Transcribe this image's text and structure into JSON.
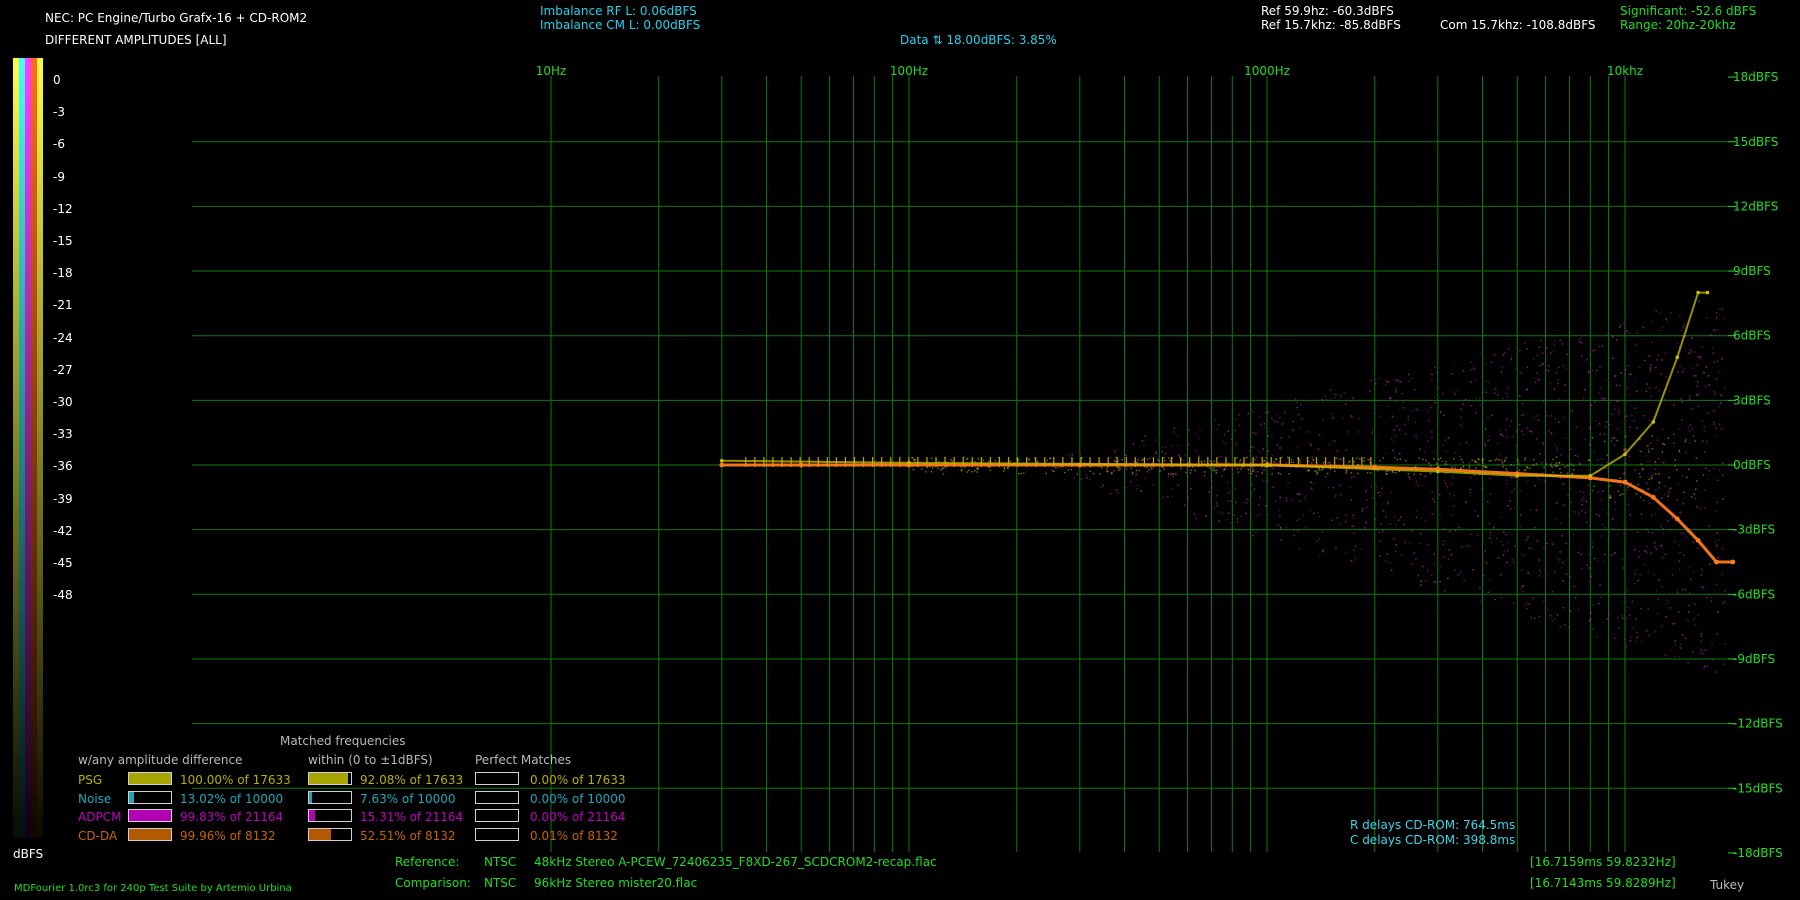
{
  "header": {
    "system": "NEC: PC Engine/Turbo Grafx-16 + CD-ROM2",
    "mode": "DIFFERENT AMPLITUDES [ALL]",
    "imbalance_rf": "Imbalance RF L: 0.06dBFS",
    "imbalance_cm": "Imbalance CM L: 0.00dBFS",
    "data_range": "Data ⇅ 18.00dBFS: 3.85%",
    "ref_60": "Ref 59.9hz:  -60.3dBFS",
    "ref_15k": "Ref 15.7khz: -85.8dBFS",
    "com_15k": "Com 15.7khz: -108.8dBFS",
    "significant": "Significant: -52.6 dBFS",
    "range": "Range: 20hz-20khz"
  },
  "colors": {
    "grid": "#0f7a0f",
    "label": "#22dd22",
    "psg": "#a7a500",
    "noise": "#21a3b3",
    "adpcm": "#b300b3",
    "cdda": "#b35a00",
    "trace": "#ff7a1a",
    "purple_points": "#b322b3"
  },
  "scale": {
    "labels": [
      "0",
      "-3",
      "-6",
      "-9",
      "-12",
      "-15",
      "-18",
      "-21",
      "-24",
      "-27",
      "-30",
      "-33",
      "-36",
      "-39",
      "-42",
      "-45",
      "-48"
    ],
    "unit": "dBFS"
  },
  "chart_data": {
    "type": "scatter",
    "xscale": "log",
    "xlabel": "",
    "ylabel": "",
    "x_ticks": [
      "10Hz",
      "100Hz",
      "1000Hz",
      "10khz"
    ],
    "y_ticks": [
      "18dBFS",
      "15dBFS",
      "12dBFS",
      "9dBFS",
      "6dBFS",
      "3dBFS",
      "0dBFS",
      "-3dBFS",
      "-6dBFS",
      "-9dBFS",
      "-12dBFS",
      "-15dBFS",
      "-18dBFS"
    ],
    "ylim": [
      -18,
      18
    ],
    "xlim_hz": [
      3,
      30000
    ],
    "grid": true,
    "series": [
      {
        "name": "CD-DA",
        "points": [
          [
            30,
            0
          ],
          [
            50,
            0
          ],
          [
            100,
            0
          ],
          [
            300,
            0
          ],
          [
            1000,
            0
          ],
          [
            2000,
            -0.1
          ],
          [
            3000,
            -0.2
          ],
          [
            5000,
            -0.4
          ],
          [
            8000,
            -0.6
          ],
          [
            10000,
            -0.8
          ],
          [
            12000,
            -1.5
          ],
          [
            14000,
            -2.5
          ],
          [
            16000,
            -3.5
          ],
          [
            18000,
            -4.5
          ],
          [
            20000,
            -4.5
          ]
        ]
      },
      {
        "name": "PSG",
        "points": [
          [
            30,
            0.2
          ],
          [
            100,
            0.1
          ],
          [
            1000,
            0
          ],
          [
            3000,
            -0.3
          ],
          [
            5000,
            -0.5
          ],
          [
            8000,
            -0.5
          ],
          [
            10000,
            0.5
          ],
          [
            12000,
            2
          ],
          [
            14000,
            5
          ],
          [
            16000,
            8
          ],
          [
            17000,
            8
          ]
        ]
      }
    ]
  },
  "legend": {
    "matched_title": "Matched frequencies",
    "col1_title": "w/any amplitude difference",
    "col2_title": "within (0 to ±1dBFS)",
    "col3_title": "Perfect Matches",
    "rows": [
      {
        "name": "PSG",
        "c1": "100.00% of 17633",
        "c2": "92.08% of 17633",
        "c3": "0.00% of 17633",
        "f1": 1.0,
        "f2": 0.9208,
        "f3": 0.0,
        "color": "#a7a500",
        "text": "#b8b000"
      },
      {
        "name": "Noise",
        "c1": "13.02% of 10000",
        "c2": "7.63% of 10000",
        "c3": "0.00% of 10000",
        "f1": 0.1302,
        "f2": 0.0763,
        "f3": 0.0,
        "color": "#21a3b3",
        "text": "#1fa8ba"
      },
      {
        "name": "ADPCM",
        "c1": "99.83% of 21164",
        "c2": "15.31% of 21164",
        "c3": "0.00% of 21164",
        "f1": 0.9983,
        "f2": 0.1531,
        "f3": 0.0,
        "color": "#b300b3",
        "text": "#c000c0"
      },
      {
        "name": "CD-DA",
        "c1": "99.96% of 8132",
        "c2": "52.51% of 8132",
        "c3": "0.01% of 8132",
        "f1": 0.9996,
        "f2": 0.5251,
        "f3": 0.0001,
        "color": "#b35a00",
        "text": "#c86400"
      }
    ]
  },
  "delays": {
    "r": "R delays   CD-ROM: 764.5ms",
    "c": "C delays   CD-ROM: 398.8ms"
  },
  "footer": {
    "reference_label": "Reference:",
    "reference_std": "NTSC",
    "reference_file": "48kHz Stereo A-PCEW_72406235_F8XD-267_SCDCROM2-recap.flac",
    "reference_timing": "[16.7159ms 59.8232Hz]",
    "comparison_label": "Comparison:",
    "comparison_std": "NTSC",
    "comparison_file": "96kHz Stereo mister20.flac",
    "comparison_timing": "[16.7143ms 59.8289Hz]",
    "credit": "MDFourier 1.0rc3 for 240p Test Suite by Artemio Urbina",
    "window": "Tukey"
  }
}
